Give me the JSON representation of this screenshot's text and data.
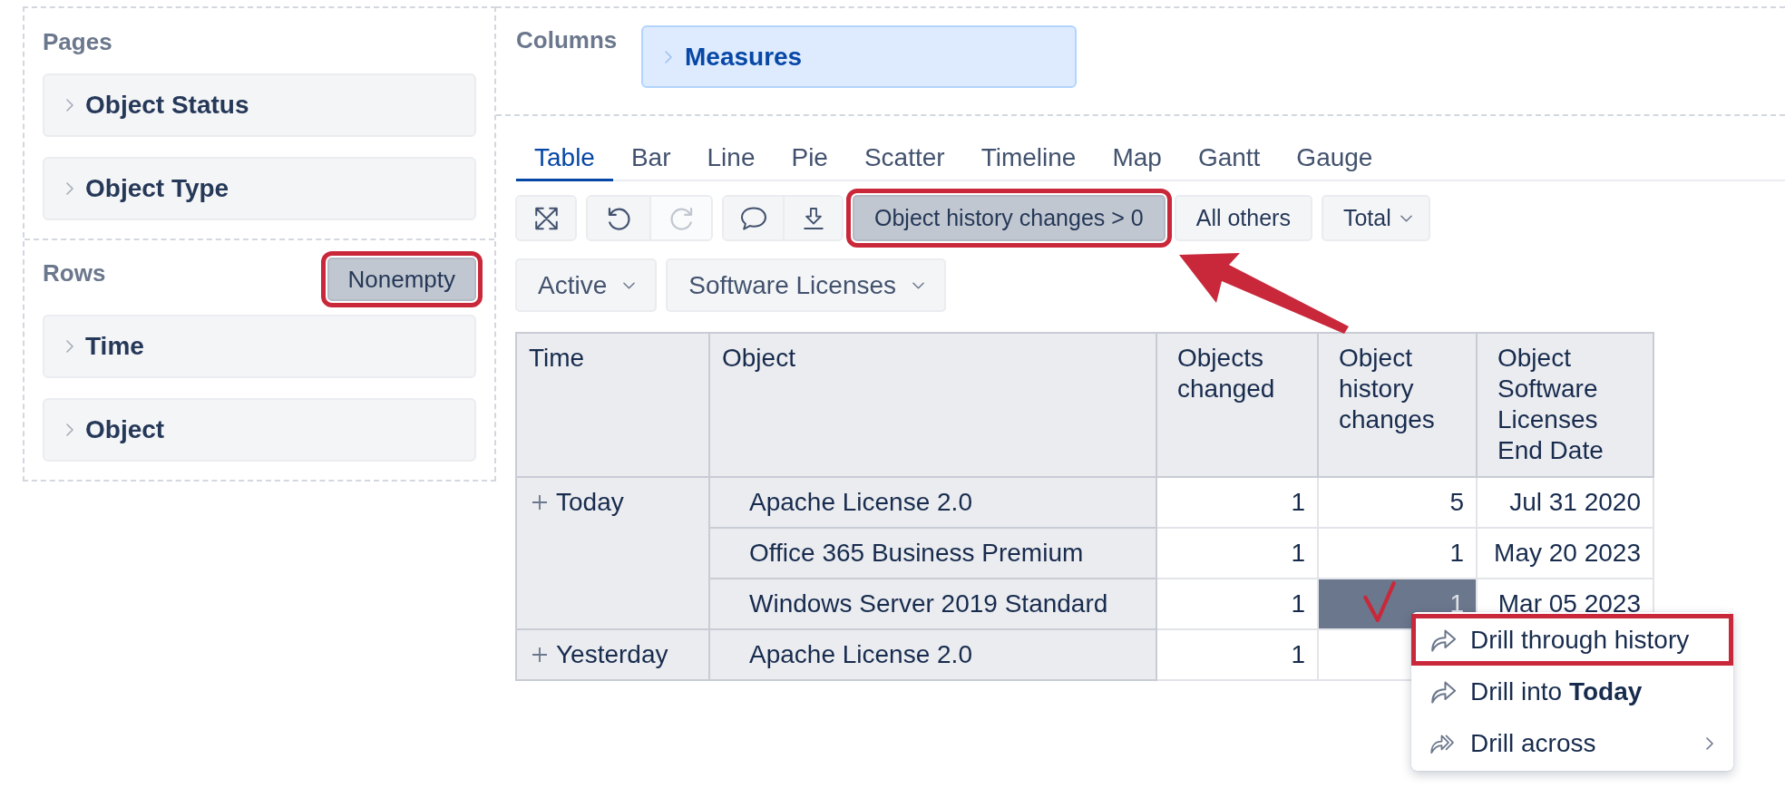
{
  "pages_panel": {
    "title": "Pages",
    "items": [
      {
        "label": "Object Status"
      },
      {
        "label": "Object Type"
      }
    ]
  },
  "rows_panel": {
    "title": "Rows",
    "toggle": {
      "label": "Nonempty",
      "selected": true,
      "outlined": true
    },
    "items": [
      {
        "label": "Time"
      },
      {
        "label": "Object"
      }
    ]
  },
  "columns_panel": {
    "title": "Columns",
    "items": [
      {
        "label": "Measures"
      }
    ]
  },
  "view_tabs": [
    {
      "label": "Table",
      "selected": true
    },
    {
      "label": "Bar",
      "selected": false
    },
    {
      "label": "Line",
      "selected": false
    },
    {
      "label": "Pie",
      "selected": false
    },
    {
      "label": "Scatter",
      "selected": false
    },
    {
      "label": "Timeline",
      "selected": false
    },
    {
      "label": "Map",
      "selected": false
    },
    {
      "label": "Gantt",
      "selected": false
    },
    {
      "label": "Gauge",
      "selected": false
    }
  ],
  "toolbar": {
    "icon_button_groups": [
      [
        {
          "disabled": false
        }
      ],
      [
        {
          "disabled": false
        },
        {
          "disabled": true
        }
      ],
      [
        {
          "disabled": false
        },
        {
          "disabled": false
        }
      ]
    ],
    "filters": [
      {
        "kind": "toggle",
        "label": "Object history changes > 0",
        "selected": true,
        "outlined": true
      },
      {
        "kind": "toggle",
        "label": "All others",
        "selected": false,
        "outlined": false
      },
      {
        "kind": "dropdown",
        "label": "Total",
        "selected": false,
        "outlined": false
      }
    ]
  },
  "page_filters": [
    {
      "label": "Active"
    },
    {
      "label": "Software Licenses"
    }
  ],
  "table": {
    "columns": [
      "Time",
      "Object",
      "Objects changed",
      "Object history changes",
      "Object Software Licenses End Date"
    ],
    "groups": [
      {
        "label": "Today",
        "expanded": false,
        "rows": [
          {
            "object": "Apache License 2.0",
            "cells": [
              {
                "value": "1",
                "selected": false,
                "ticked": false
              },
              {
                "value": "5",
                "selected": false,
                "ticked": false
              },
              {
                "value": "Jul 31 2020",
                "selected": false,
                "ticked": false
              }
            ]
          },
          {
            "object": "Office 365 Business Premium",
            "cells": [
              {
                "value": "1",
                "selected": false,
                "ticked": false
              },
              {
                "value": "1",
                "selected": false,
                "ticked": false
              },
              {
                "value": "May 20 2023",
                "selected": false,
                "ticked": false
              }
            ]
          },
          {
            "object": "Windows Server 2019 Standard",
            "cells": [
              {
                "value": "1",
                "selected": false,
                "ticked": false
              },
              {
                "value": "1",
                "selected": true,
                "ticked": true
              },
              {
                "value": "Mar 05 2023",
                "selected": false,
                "ticked": false
              }
            ]
          }
        ]
      },
      {
        "label": "Yesterday",
        "expanded": false,
        "rows": [
          {
            "object": "Apache License 2.0",
            "cells": [
              {
                "value": "1",
                "selected": false,
                "ticked": false
              },
              {
                "selected": false,
                "ticked": false
              }
            ]
          }
        ]
      }
    ]
  },
  "context_menu": {
    "items": [
      {
        "label": "Drill through history",
        "outlined": true,
        "submenu": false
      },
      {
        "label": "Drill into **Today**",
        "outlined": false,
        "submenu": false
      },
      {
        "label": "Drill across",
        "outlined": false,
        "submenu": true
      }
    ]
  }
}
